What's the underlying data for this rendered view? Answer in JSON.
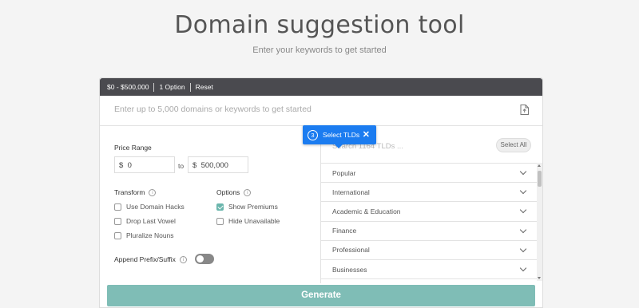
{
  "header": {
    "title": "Domain suggestion tool",
    "subtitle": "Enter your keywords to get started"
  },
  "toolbar": {
    "price_summary": "$0 - $500,000",
    "options_summary": "1 Option",
    "reset_label": "Reset"
  },
  "keywords": {
    "placeholder": "Enter up to 5,000 domains or keywords to get started",
    "upload_icon": "file-upload-icon"
  },
  "price_range": {
    "label": "Price Range",
    "min_prefix": "$",
    "min_value": "0",
    "to_label": "to",
    "max_prefix": "$",
    "max_value": "500,000"
  },
  "transform": {
    "label": "Transform",
    "items": [
      {
        "label": "Use Domain Hacks",
        "checked": false
      },
      {
        "label": "Drop Last Vowel",
        "checked": false
      },
      {
        "label": "Pluralize Nouns",
        "checked": false
      }
    ]
  },
  "options": {
    "label": "Options",
    "items": [
      {
        "label": "Show Premiums",
        "checked": true
      },
      {
        "label": "Hide Unavailable",
        "checked": false
      }
    ]
  },
  "append": {
    "label": "Append Prefix/Suffix",
    "enabled": false
  },
  "tlds": {
    "search_placeholder": "Search 1164 TLDs ...",
    "select_all_label": "Select All",
    "categories": [
      "Popular",
      "International",
      "Academic & Education",
      "Finance",
      "Professional",
      "Businesses"
    ]
  },
  "tooltip": {
    "step": "3",
    "label": "Select TLDs",
    "close": "✕",
    "color": "#1b7cf0"
  },
  "generate": {
    "label": "Generate",
    "color": "#7fbdb6"
  }
}
